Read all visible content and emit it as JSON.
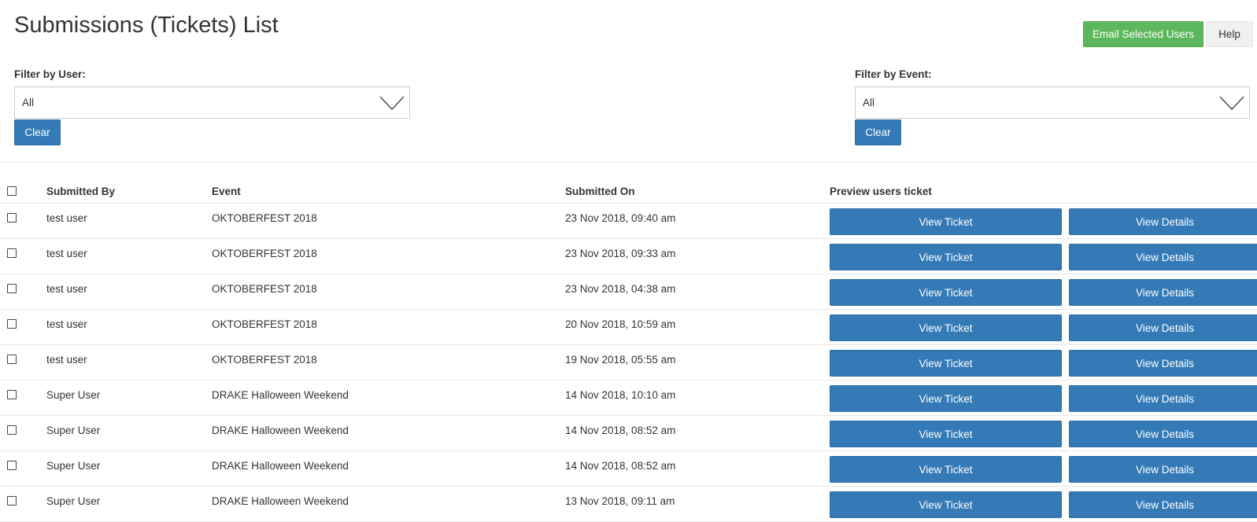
{
  "header": {
    "title": "Submissions (Tickets) List",
    "email_button": "Email Selected Users",
    "help_button": "Help"
  },
  "filters": {
    "user": {
      "label": "Filter by User:",
      "value": "All",
      "clear_label": "Clear"
    },
    "event": {
      "label": "Filter by Event:",
      "value": "All",
      "clear_label": "Clear"
    }
  },
  "table": {
    "columns": {
      "submitted_by": "Submitted By",
      "event": "Event",
      "submitted_on": "Submitted On",
      "preview": "Preview users ticket"
    },
    "rows": [
      {
        "submitted_by": "test user",
        "event": "OKTOBERFEST 2018",
        "submitted_on": "23 Nov 2018, 09:40 am",
        "view_ticket": "View Ticket",
        "view_details": "View Details"
      },
      {
        "submitted_by": "test user",
        "event": "OKTOBERFEST 2018",
        "submitted_on": "23 Nov 2018, 09:33 am",
        "view_ticket": "View Ticket",
        "view_details": "View Details"
      },
      {
        "submitted_by": "test user",
        "event": "OKTOBERFEST 2018",
        "submitted_on": "23 Nov 2018, 04:38 am",
        "view_ticket": "View Ticket",
        "view_details": "View Details"
      },
      {
        "submitted_by": "test user",
        "event": "OKTOBERFEST 2018",
        "submitted_on": "20 Nov 2018, 10:59 am",
        "view_ticket": "View Ticket",
        "view_details": "View Details"
      },
      {
        "submitted_by": "test user",
        "event": "OKTOBERFEST 2018",
        "submitted_on": "19 Nov 2018, 05:55 am",
        "view_ticket": "View Ticket",
        "view_details": "View Details"
      },
      {
        "submitted_by": "Super User",
        "event": "DRAKE Halloween Weekend",
        "submitted_on": "14 Nov 2018, 10:10 am",
        "view_ticket": "View Ticket",
        "view_details": "View Details"
      },
      {
        "submitted_by": "Super User",
        "event": "DRAKE Halloween Weekend",
        "submitted_on": "14 Nov 2018, 08:52 am",
        "view_ticket": "View Ticket",
        "view_details": "View Details"
      },
      {
        "submitted_by": "Super User",
        "event": "DRAKE Halloween Weekend",
        "submitted_on": "14 Nov 2018, 08:52 am",
        "view_ticket": "View Ticket",
        "view_details": "View Details"
      },
      {
        "submitted_by": "Super User",
        "event": "DRAKE Halloween Weekend",
        "submitted_on": "13 Nov 2018, 09:11 am",
        "view_ticket": "View Ticket",
        "view_details": "View Details"
      }
    ]
  },
  "colors": {
    "primary": "#337ab7",
    "success": "#5cb85c",
    "help_bg": "#f0f0f0",
    "text": "#333333",
    "border": "#e6e6e6"
  }
}
